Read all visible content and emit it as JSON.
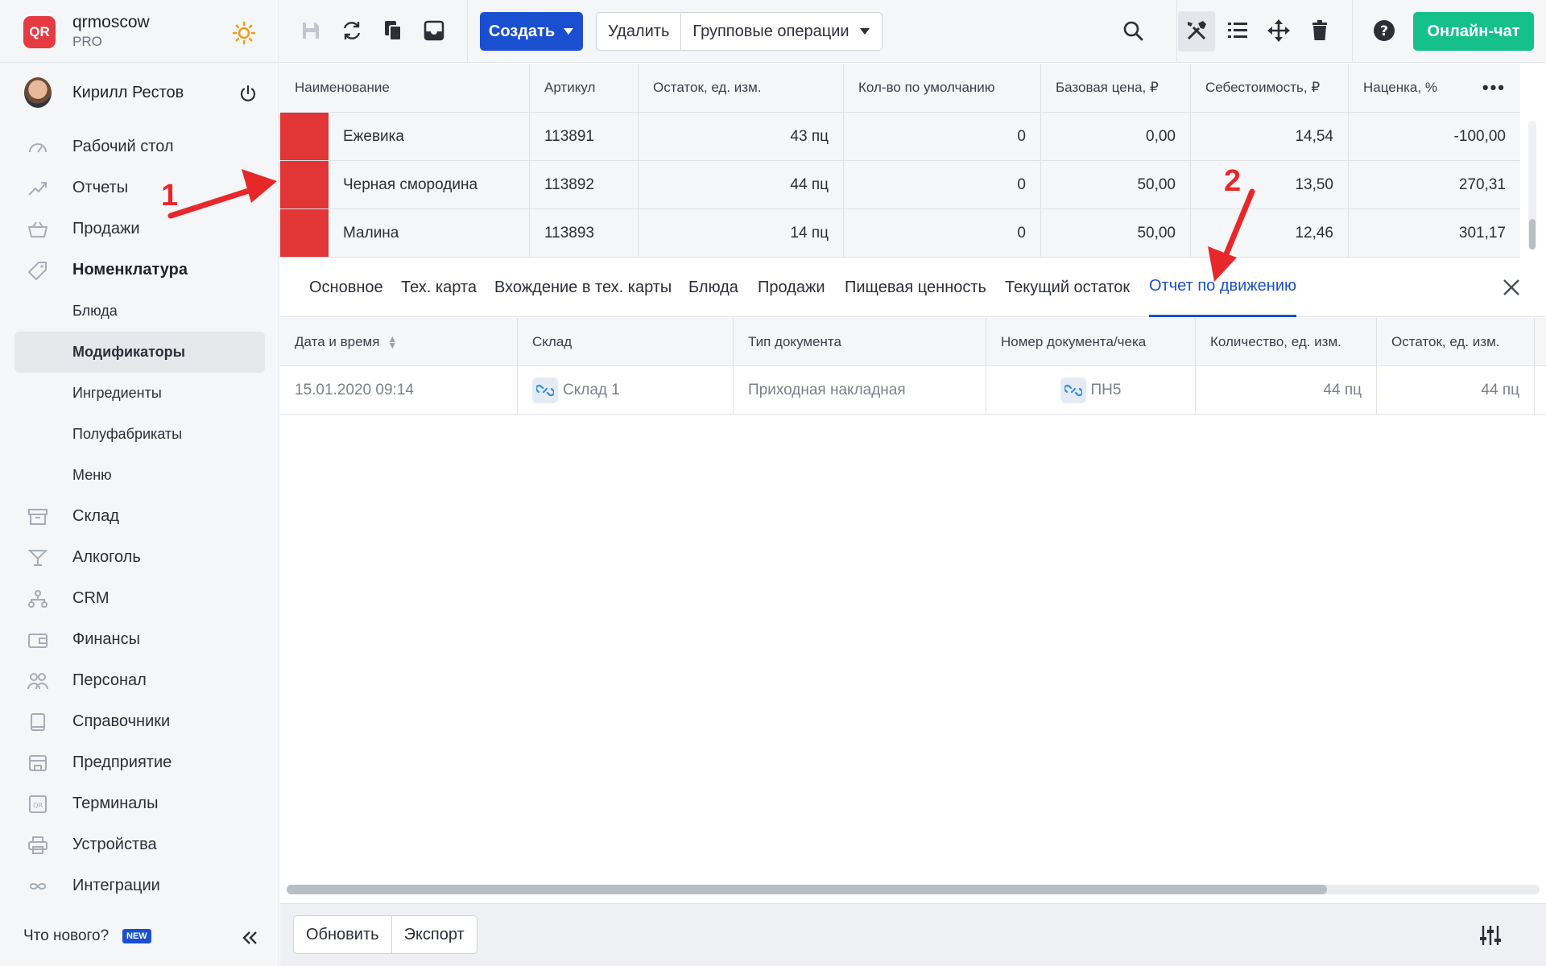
{
  "brand": {
    "logo": "QR",
    "name": "qrmoscow",
    "plan": "PRO"
  },
  "user": {
    "name": "Кирилл Рестов"
  },
  "nav": {
    "dashboard": "Рабочий стол",
    "reports": "Отчеты",
    "sales": "Продажи",
    "nomenclature": "Номенклатура",
    "dishes": "Блюда",
    "modifiers": "Модификаторы",
    "ingredients": "Ингредиенты",
    "semis": "Полуфабрикаты",
    "menu": "Меню",
    "warehouse": "Склад",
    "alcohol": "Алкоголь",
    "crm": "CRM",
    "finance": "Финансы",
    "staff": "Персонал",
    "references": "Справочники",
    "enterprise": "Предприятие",
    "terminals": "Терминалы",
    "devices": "Устройства",
    "integrations": "Интеграции"
  },
  "sidebar_footer": {
    "whats_new": "Что нового?",
    "badge": "NEW"
  },
  "toolbar": {
    "create": "Создать",
    "delete": "Удалить",
    "group_ops": "Групповые операции",
    "chat": "Онлайн-чат"
  },
  "top_table": {
    "headers": [
      "Наименование",
      "Артикул",
      "Остаток, ед. изм.",
      "Кол-во по умолчанию",
      "Базовая цена, ₽",
      "Себестоимость, ₽",
      "Наценка, %"
    ],
    "rows": [
      {
        "name": "Ежевика",
        "article": "113891",
        "stock": "43 пц",
        "default_qty": "0",
        "price": "0,00",
        "cost": "14,54",
        "markup": "-100,00",
        "color": "#e23535"
      },
      {
        "name": "Черная смородина",
        "article": "113892",
        "stock": "44 пц",
        "default_qty": "0",
        "price": "50,00",
        "cost": "13,50",
        "markup": "270,31",
        "color": "#e23535"
      },
      {
        "name": "Малина",
        "article": "113893",
        "stock": "14 пц",
        "default_qty": "0",
        "price": "50,00",
        "cost": "12,46",
        "markup": "301,17",
        "color": "#e23535"
      }
    ]
  },
  "tabs": [
    "Основное",
    "Тех. карта",
    "Вхождение в тех. карты",
    "Блюда",
    "Продажи",
    "Пищевая ценность",
    "Текущий остаток",
    "Отчет по движению"
  ],
  "active_tab": "Отчет по движению",
  "bottom_table": {
    "headers": [
      "Дата и время",
      "Склад",
      "Тип документа",
      "Номер документа/чека",
      "Количество, ед. изм.",
      "Остаток, ед. изм."
    ],
    "rows": [
      {
        "datetime": "15.01.2020 09:14",
        "warehouse": "Склад 1",
        "doc_type": "Приходная накладная",
        "doc_number": "ПН5",
        "qty": "44 пц",
        "rest": "44 пц"
      }
    ]
  },
  "footer": {
    "refresh": "Обновить",
    "export": "Экспорт"
  },
  "annotations": {
    "one": "1",
    "two": "2"
  },
  "colors": {
    "accent": "#1a4fd0",
    "chat": "#16c08a",
    "annotation": "#e8272a"
  }
}
